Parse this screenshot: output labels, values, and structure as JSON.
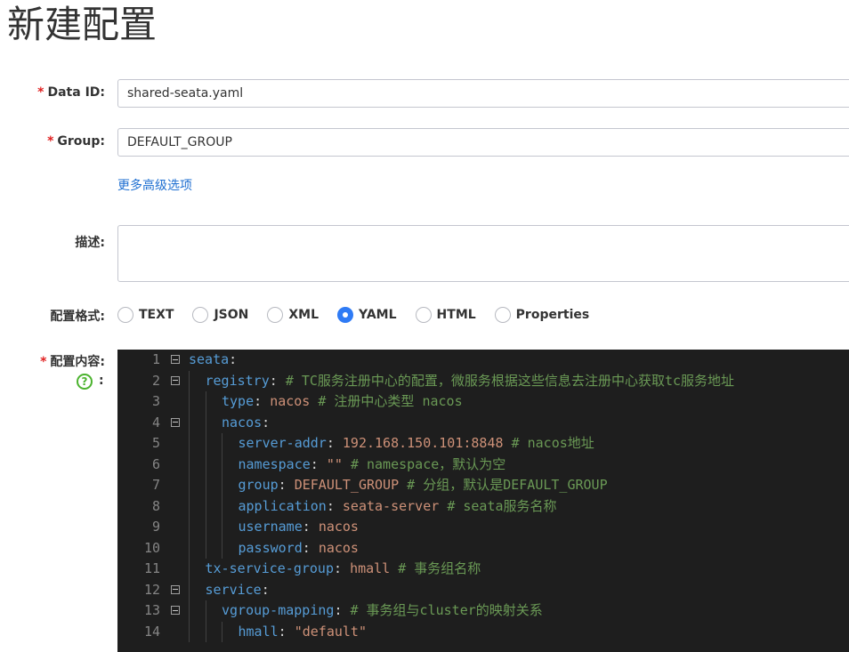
{
  "page": {
    "title": "新建配置"
  },
  "form": {
    "data_id": {
      "label": "Data ID:",
      "value": "shared-seata.yaml"
    },
    "group": {
      "label": "Group:",
      "value": "DEFAULT_GROUP"
    },
    "advanced_link": "更多高级选项",
    "description": {
      "label": "描述:",
      "value": ""
    },
    "format": {
      "label": "配置格式:",
      "options": [
        "TEXT",
        "JSON",
        "XML",
        "YAML",
        "HTML",
        "Properties"
      ],
      "selected": "YAML"
    },
    "content": {
      "label": "配置内容:",
      "help_icon": "?",
      "help_colon": ":"
    },
    "required_mark": "*"
  },
  "editor": {
    "lines": [
      {
        "n": "1",
        "fold": true,
        "indent": 0,
        "tokens": [
          {
            "t": "k",
            "s": "seata"
          },
          {
            "t": "p",
            "s": ":"
          }
        ]
      },
      {
        "n": "2",
        "fold": true,
        "indent": 1,
        "tokens": [
          {
            "t": "k",
            "s": "registry"
          },
          {
            "t": "p",
            "s": ": "
          },
          {
            "t": "c",
            "s": "# TC服务注册中心的配置，微服务根据这些信息去注册中心获取tc服务地址"
          }
        ]
      },
      {
        "n": "3",
        "fold": false,
        "indent": 2,
        "tokens": [
          {
            "t": "k",
            "s": "type"
          },
          {
            "t": "p",
            "s": ": "
          },
          {
            "t": "v",
            "s": "nacos "
          },
          {
            "t": "c",
            "s": "# 注册中心类型 nacos"
          }
        ]
      },
      {
        "n": "4",
        "fold": true,
        "indent": 2,
        "tokens": [
          {
            "t": "k",
            "s": "nacos"
          },
          {
            "t": "p",
            "s": ":"
          }
        ]
      },
      {
        "n": "5",
        "fold": false,
        "indent": 3,
        "tokens": [
          {
            "t": "k",
            "s": "server-addr"
          },
          {
            "t": "p",
            "s": ": "
          },
          {
            "t": "v",
            "s": "192.168.150.101:8848 "
          },
          {
            "t": "c",
            "s": "# nacos地址"
          }
        ]
      },
      {
        "n": "6",
        "fold": false,
        "indent": 3,
        "tokens": [
          {
            "t": "k",
            "s": "namespace"
          },
          {
            "t": "p",
            "s": ": "
          },
          {
            "t": "v",
            "s": "\"\" "
          },
          {
            "t": "c",
            "s": "# namespace，默认为空"
          }
        ]
      },
      {
        "n": "7",
        "fold": false,
        "indent": 3,
        "tokens": [
          {
            "t": "k",
            "s": "group"
          },
          {
            "t": "p",
            "s": ": "
          },
          {
            "t": "v",
            "s": "DEFAULT_GROUP "
          },
          {
            "t": "c",
            "s": "# 分组，默认是DEFAULT_GROUP"
          }
        ]
      },
      {
        "n": "8",
        "fold": false,
        "indent": 3,
        "tokens": [
          {
            "t": "k",
            "s": "application"
          },
          {
            "t": "p",
            "s": ": "
          },
          {
            "t": "v",
            "s": "seata-server "
          },
          {
            "t": "c",
            "s": "# seata服务名称"
          }
        ]
      },
      {
        "n": "9",
        "fold": false,
        "indent": 3,
        "tokens": [
          {
            "t": "k",
            "s": "username"
          },
          {
            "t": "p",
            "s": ": "
          },
          {
            "t": "v",
            "s": "nacos"
          }
        ]
      },
      {
        "n": "10",
        "fold": false,
        "indent": 3,
        "tokens": [
          {
            "t": "k",
            "s": "password"
          },
          {
            "t": "p",
            "s": ": "
          },
          {
            "t": "v",
            "s": "nacos"
          }
        ]
      },
      {
        "n": "11",
        "fold": false,
        "indent": 1,
        "tokens": [
          {
            "t": "k",
            "s": "tx-service-group"
          },
          {
            "t": "p",
            "s": ": "
          },
          {
            "t": "v",
            "s": "hmall "
          },
          {
            "t": "c",
            "s": "# 事务组名称"
          }
        ]
      },
      {
        "n": "12",
        "fold": true,
        "indent": 1,
        "tokens": [
          {
            "t": "k",
            "s": "service"
          },
          {
            "t": "p",
            "s": ":"
          }
        ]
      },
      {
        "n": "13",
        "fold": true,
        "indent": 2,
        "tokens": [
          {
            "t": "k",
            "s": "vgroup-mapping"
          },
          {
            "t": "p",
            "s": ": "
          },
          {
            "t": "c",
            "s": "# 事务组与cluster的映射关系"
          }
        ]
      },
      {
        "n": "14",
        "fold": false,
        "indent": 3,
        "tokens": [
          {
            "t": "k",
            "s": "hmall"
          },
          {
            "t": "p",
            "s": ": "
          },
          {
            "t": "v",
            "s": "\"default\""
          }
        ]
      }
    ]
  }
}
